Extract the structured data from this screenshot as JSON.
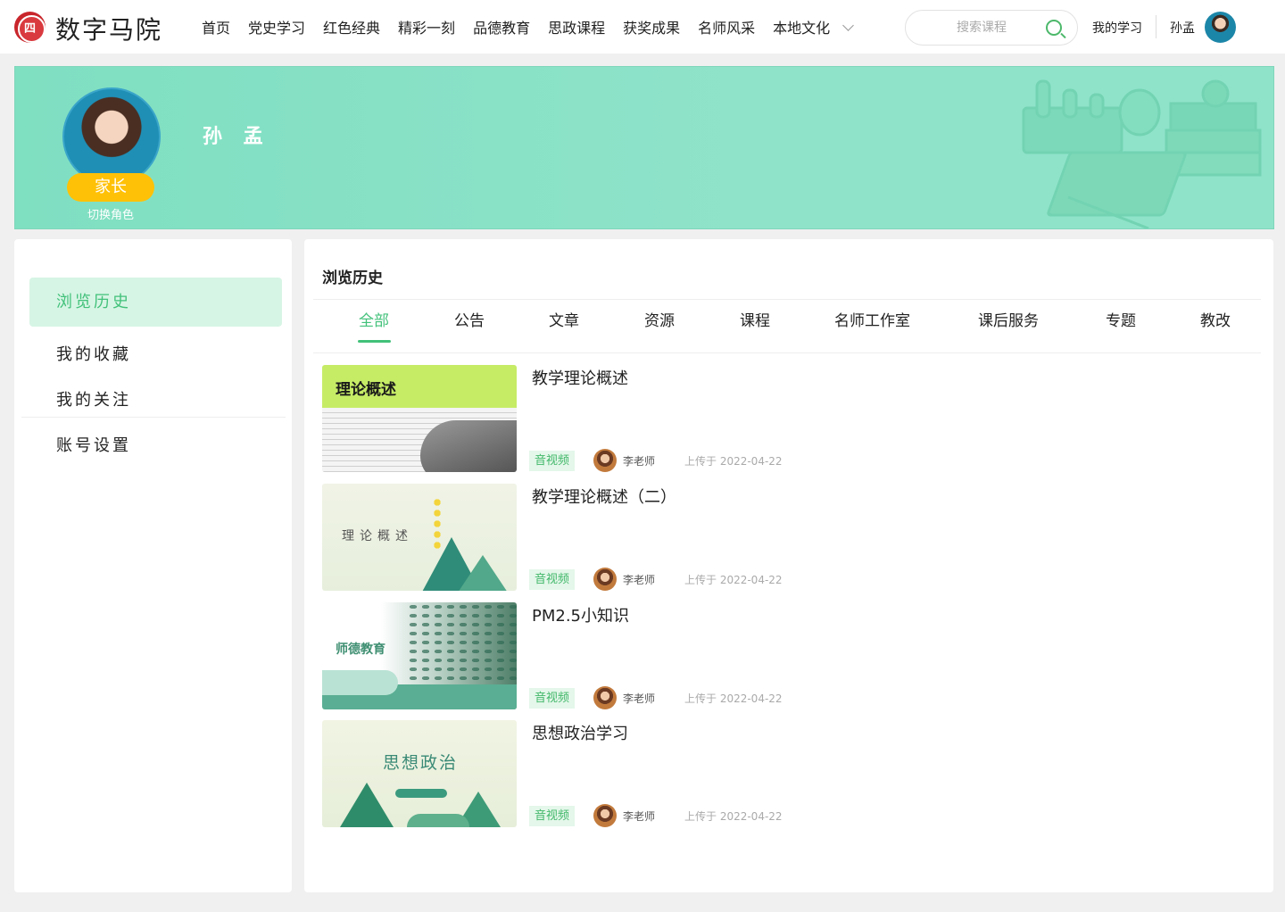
{
  "header": {
    "logo_mark": "四",
    "site_name": "数字马院",
    "nav": [
      "首页",
      "党史学习",
      "红色经典",
      "精彩一刻",
      "品德教育",
      "思政课程",
      "获奖成果",
      "名师风采",
      "本地文化"
    ],
    "search_placeholder": "搜索课程",
    "my_study": "我的学习",
    "username": "孙孟"
  },
  "banner": {
    "name": "孙 孟",
    "role": "家长",
    "switch_role": "切换角色"
  },
  "sidebar": {
    "items": [
      "浏览历史",
      "我的收藏",
      "我的关注",
      "账号设置"
    ],
    "active_index": 0
  },
  "main": {
    "title": "浏览历史",
    "tabs": [
      "全部",
      "公告",
      "文章",
      "资源",
      "课程",
      "名师工作室",
      "课后服务",
      "专题",
      "教改"
    ],
    "active_tab": 0,
    "items": [
      {
        "title": "教学理论概述",
        "thumb_text": "理论概述",
        "tag": "音视频",
        "author": "李老师",
        "date": "上传于 2022-04-22"
      },
      {
        "title": "教学理论概述（二）",
        "thumb_text": "理论概述",
        "tag": "音视频",
        "author": "李老师",
        "date": "上传于 2022-04-22"
      },
      {
        "title": "PM2.5小知识",
        "thumb_text": "师德教育",
        "tag": "音视频",
        "author": "李老师",
        "date": "上传于 2022-04-22"
      },
      {
        "title": "思想政治学习",
        "thumb_text": "思想政治",
        "tag": "音视频",
        "author": "李老师",
        "date": "上传于 2022-04-22"
      }
    ]
  },
  "colors": {
    "accent_green": "#42c17a",
    "banner_teal": "#8fe3c9",
    "role_badge": "#ffc107",
    "logo_red": "#c8262c"
  }
}
